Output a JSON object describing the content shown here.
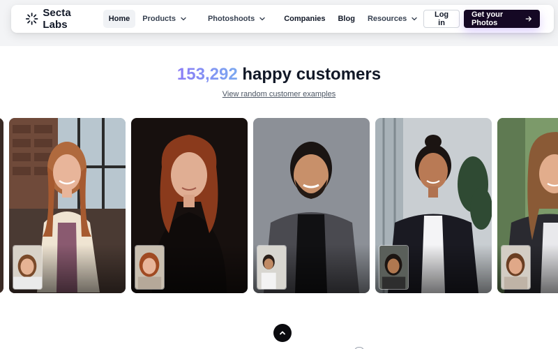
{
  "brand": {
    "name": "Secta Labs",
    "logo_icon": "sunburst-logo-icon"
  },
  "nav": {
    "items": [
      {
        "label": "Home",
        "active": true,
        "has_dropdown": false
      },
      {
        "label": "Products",
        "active": false,
        "has_dropdown": true
      },
      {
        "label": "Photoshoots",
        "active": false,
        "has_dropdown": true
      },
      {
        "label": "Companies",
        "active": false,
        "has_dropdown": false
      },
      {
        "label": "Blog",
        "active": false,
        "has_dropdown": false
      },
      {
        "label": "Resources",
        "active": false,
        "has_dropdown": true
      }
    ],
    "login_label": "Log in",
    "cta_label": "Get your Photos",
    "cta_icon": "arrow-right-icon"
  },
  "hero": {
    "count": "153,292",
    "headline_rest": "happy customers",
    "examples_link": "View random customer examples"
  },
  "gallery": {
    "cards": [
      {
        "name": "partial-card"
      },
      {
        "name": "woman-cream-blazer"
      },
      {
        "name": "woman-red-curly-hair"
      },
      {
        "name": "man-gray-blazer"
      },
      {
        "name": "woman-black-blazer"
      },
      {
        "name": "woman-long-hair-partial"
      }
    ]
  },
  "scroll_top_icon": "chevron-up-icon",
  "colors": {
    "accent_gradient_start": "#8b7cf6",
    "accent_gradient_end": "#7aa8f0",
    "cta_background": "#150824",
    "text_primary": "#111827"
  }
}
